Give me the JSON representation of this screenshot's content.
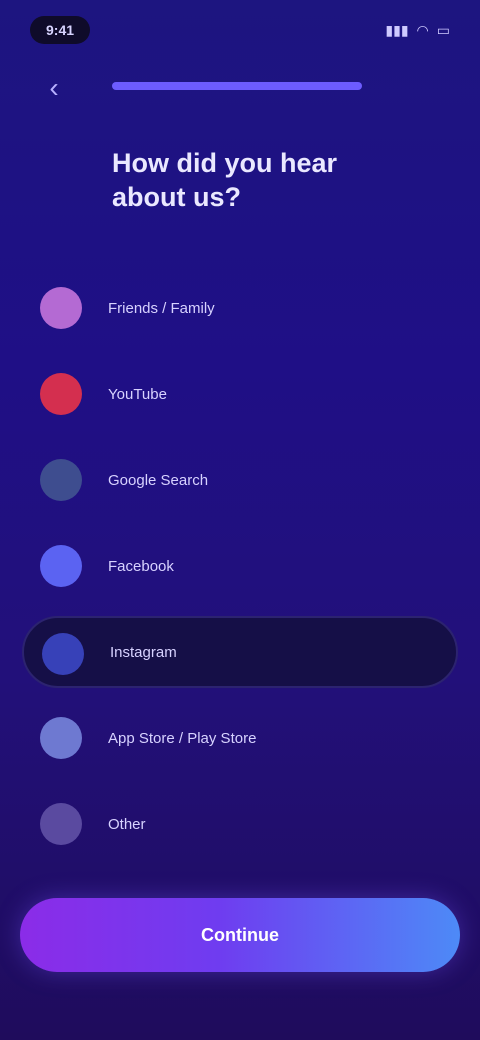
{
  "status_bar": {
    "time": "9:41",
    "signal_icon": "signal-icon",
    "wifi_icon": "wifi-icon",
    "battery_icon": "battery-icon"
  },
  "nav": {
    "back_icon": "back-arrow-icon"
  },
  "progress": {
    "value_percent": 100,
    "fill_color": "#6d5cff",
    "track_color": "#3b2fb8"
  },
  "question": {
    "text": "How did you hear about us?"
  },
  "options": [
    {
      "label": "Friends / Family",
      "color": "#b46ad3",
      "selected": false
    },
    {
      "label": "YouTube",
      "color": "#d42f4f",
      "selected": false
    },
    {
      "label": "Google Search",
      "color": "#3e4d8f",
      "selected": false
    },
    {
      "label": "Facebook",
      "color": "#5b63f2",
      "selected": false
    },
    {
      "label": "Instagram",
      "color": "#3741b8",
      "selected": true
    },
    {
      "label": "App Store / Play Store",
      "color": "#6e79d1",
      "selected": false
    },
    {
      "label": "Other",
      "color": "#5a4aa0",
      "selected": false
    }
  ],
  "cta": {
    "label": "Continue"
  }
}
